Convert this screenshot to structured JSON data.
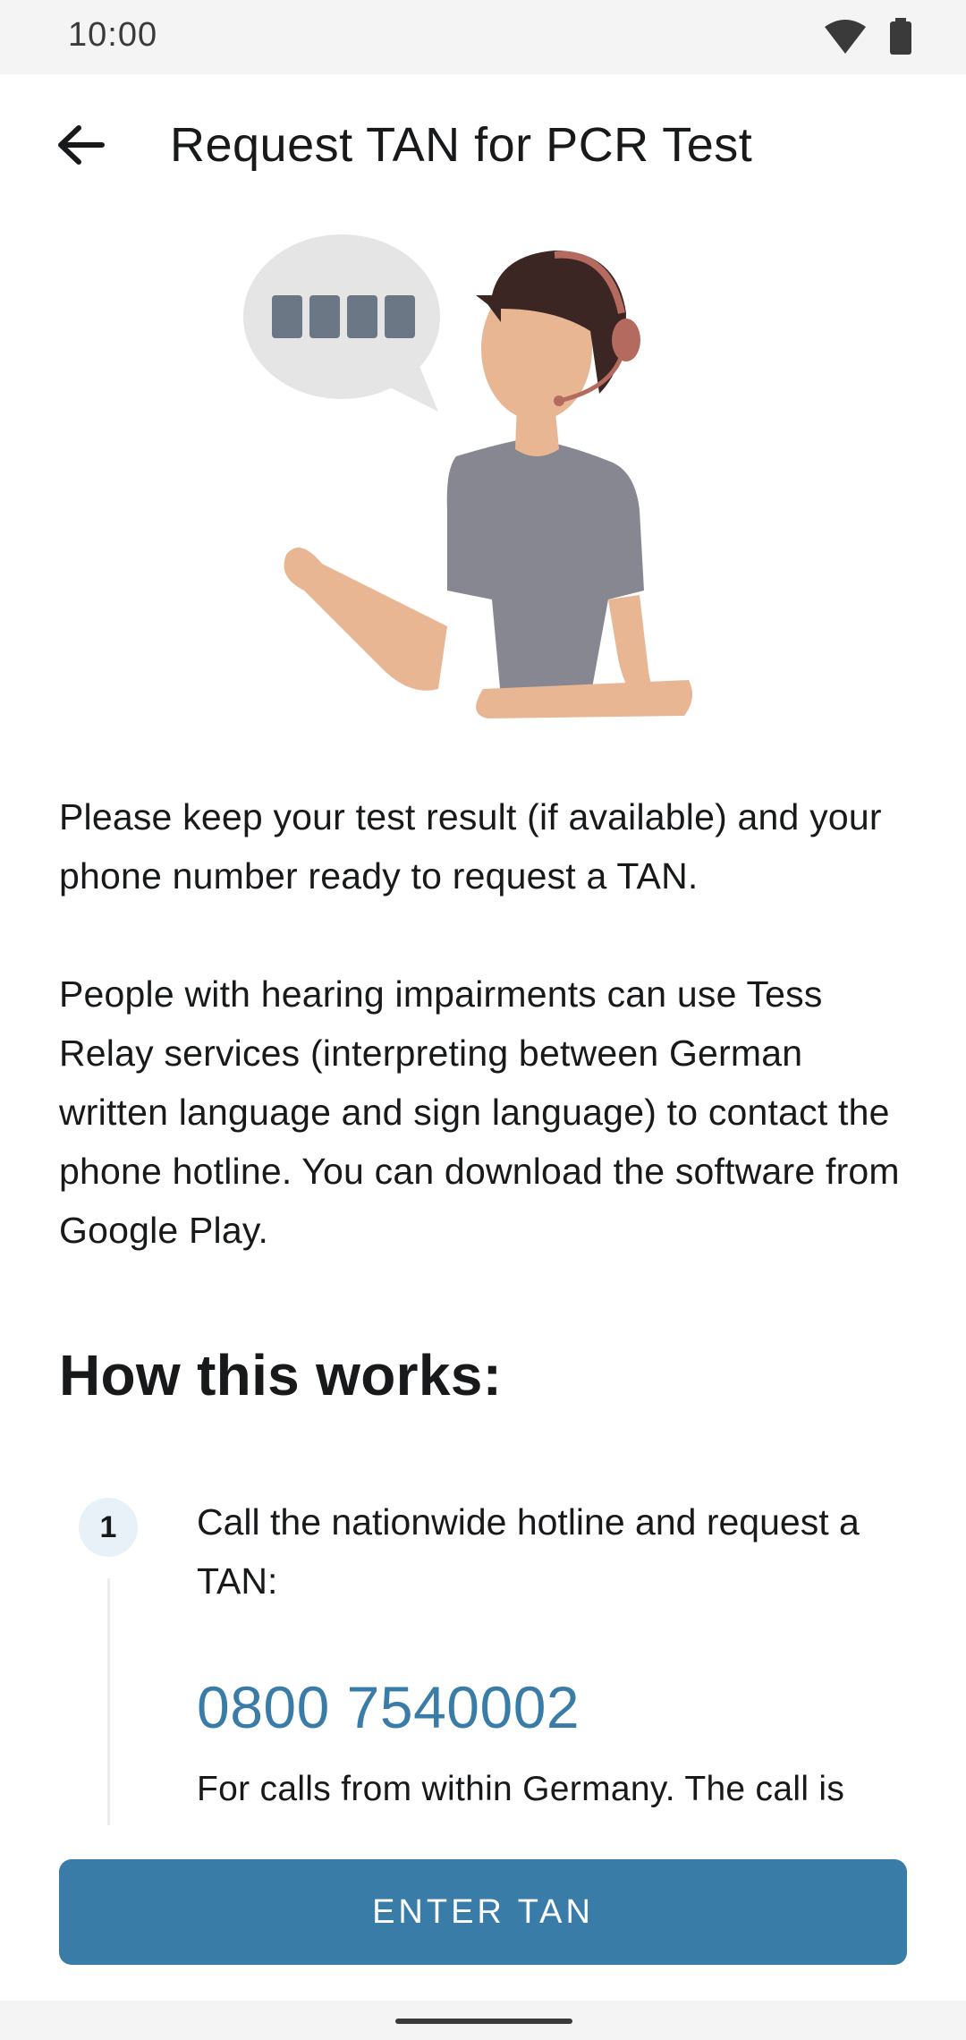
{
  "status_bar": {
    "time": "10:00",
    "icons": [
      "wifi-icon",
      "battery-icon"
    ]
  },
  "app_bar": {
    "back_icon": "arrow-back-icon",
    "title": "Request TAN for PCR Test"
  },
  "intro": {
    "paragraph_1": "Please keep your test result (if available) and your phone number ready to request a TAN.",
    "paragraph_2": "People with hearing impairments can use Tess Relay services (interpreting between German written language and sign language) to contact the phone hotline. You can download the software from Google Play."
  },
  "how_it_works": {
    "title": "How this works:",
    "steps": [
      {
        "number": "1",
        "text": "Call the nationwide hotline and request a TAN:",
        "hotline": "0800 7540002",
        "note": "For calls from within Germany. The call is"
      }
    ]
  },
  "actions": {
    "enter_tan_label": "ENTER TAN"
  },
  "colors": {
    "accent": "#3a7ca8",
    "step_circle_bg": "#e8f1f8",
    "text": "#17191a",
    "status_bar_bg": "#f4f4f4"
  }
}
